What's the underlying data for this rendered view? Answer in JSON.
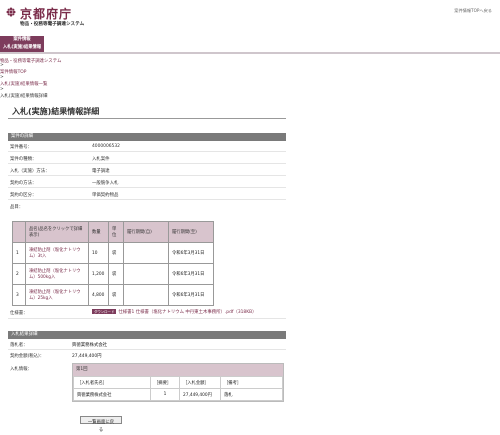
{
  "header": {
    "logo_title": "京都府庁",
    "logo_subtitle": "物品・役務等電子調達システム",
    "top_link": "案件情報TOPへ戻る"
  },
  "menu": {
    "item1": "案件情報",
    "item2": "入札(実施)結果情報"
  },
  "breadcrumb": [
    {
      "label": "物品・役務等電子調達システム",
      "link": true
    },
    {
      "label": ">",
      "link": false
    },
    {
      "label": "案件情報TOP",
      "link": true
    },
    {
      "label": ">",
      "link": false
    },
    {
      "label": "入札(実施)結果情報一覧",
      "link": true
    },
    {
      "label": ">",
      "link": false
    },
    {
      "label": "入札(実施)結果情報詳細",
      "link": false
    }
  ],
  "page_title": "入札(実施)結果情報詳細",
  "case_section": {
    "title": "案件の詳細",
    "rows": [
      {
        "label": "案件番号：",
        "value": "4000006532"
      },
      {
        "label": "案件の種類：",
        "value": "入札案件"
      },
      {
        "label": "入札（実施）方法：",
        "value": "電子調達"
      },
      {
        "label": "契約の方法：",
        "value": "一般競争入札"
      },
      {
        "label": "契約の区分：",
        "value": "単価契約物品"
      },
      {
        "label": "品目：",
        "value": ""
      }
    ]
  },
  "items_table": {
    "headers": [
      "",
      "品名(品名をクリックで詳細表示)",
      "数量",
      "単位",
      "履行期間(自)",
      "履行期間(至)"
    ],
    "rows": [
      {
        "no": "1",
        "name": "凍結防止剤（塩化ナトリウム）3t入",
        "qty": "10",
        "unit": "袋",
        "from": "",
        "to": "令和6年3月31日"
      },
      {
        "no": "2",
        "name": "凍結防止剤（塩化ナトリウム）500kg入",
        "qty": "1,200",
        "unit": "袋",
        "from": "",
        "to": "令和6年3月31日"
      },
      {
        "no": "3",
        "name": "凍結防止剤（塩化ナトリウム）25kg入",
        "qty": "4,800",
        "unit": "袋",
        "from": "",
        "to": "令和6年3月31日"
      }
    ]
  },
  "spec": {
    "label": "仕様書：",
    "icon_text": "ダウンロード",
    "link": "仕様書1 仕様書（塩化ナトリウム 中丹東土木事務所）.pdf（318KB）"
  },
  "result_section": {
    "title": "入札結果詳細",
    "winner_label": "落札者：",
    "winner_value": "興徳業務株式会社",
    "amount_label": "契約金額(税込)：",
    "amount_value": "27,449,400円",
    "bid_info_label": "入札情報：",
    "round": "第1回",
    "bid_headers": [
      "［入札者氏名］",
      "［摘要］",
      "［入札金額］",
      "［備考］"
    ],
    "bid_row": [
      "興徳業務株式会社",
      "1",
      "27,449,400円",
      "落札"
    ]
  },
  "back_button": "一覧画面に戻る"
}
